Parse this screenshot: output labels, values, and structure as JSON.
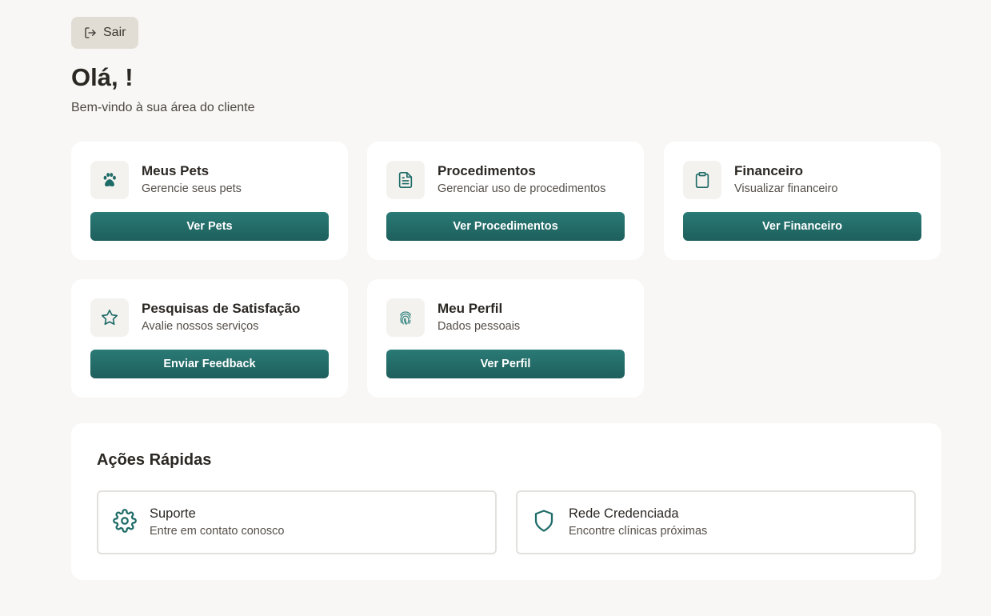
{
  "header": {
    "logout_label": "Sair",
    "greeting": "Olá, !",
    "subtitle": "Bem-vindo à sua área do cliente"
  },
  "cards": [
    {
      "title": "Meus Pets",
      "description": "Gerencie seus pets",
      "button": "Ver Pets",
      "icon": "paw-icon"
    },
    {
      "title": "Procedimentos",
      "description": "Gerenciar uso de procedimentos",
      "button": "Ver Procedimentos",
      "icon": "document-icon"
    },
    {
      "title": "Financeiro",
      "description": "Visualizar financeiro",
      "button": "Ver Financeiro",
      "icon": "clipboard-icon"
    },
    {
      "title": "Pesquisas de Satisfação",
      "description": "Avalie nossos serviços",
      "button": "Enviar Feedback",
      "icon": "star-icon"
    },
    {
      "title": "Meu Perfil",
      "description": "Dados pessoais",
      "button": "Ver Perfil",
      "icon": "fingerprint-icon"
    }
  ],
  "quick_actions": {
    "title": "Ações Rápidas",
    "items": [
      {
        "title": "Suporte",
        "description": "Entre em contato conosco",
        "icon": "gear-icon"
      },
      {
        "title": "Rede Credenciada",
        "description": "Encontre clínicas próximas",
        "icon": "shield-icon"
      }
    ]
  },
  "colors": {
    "background": "#f8f7f5",
    "accent": "#1e6b67",
    "logout_button": "#e2ddd4"
  }
}
